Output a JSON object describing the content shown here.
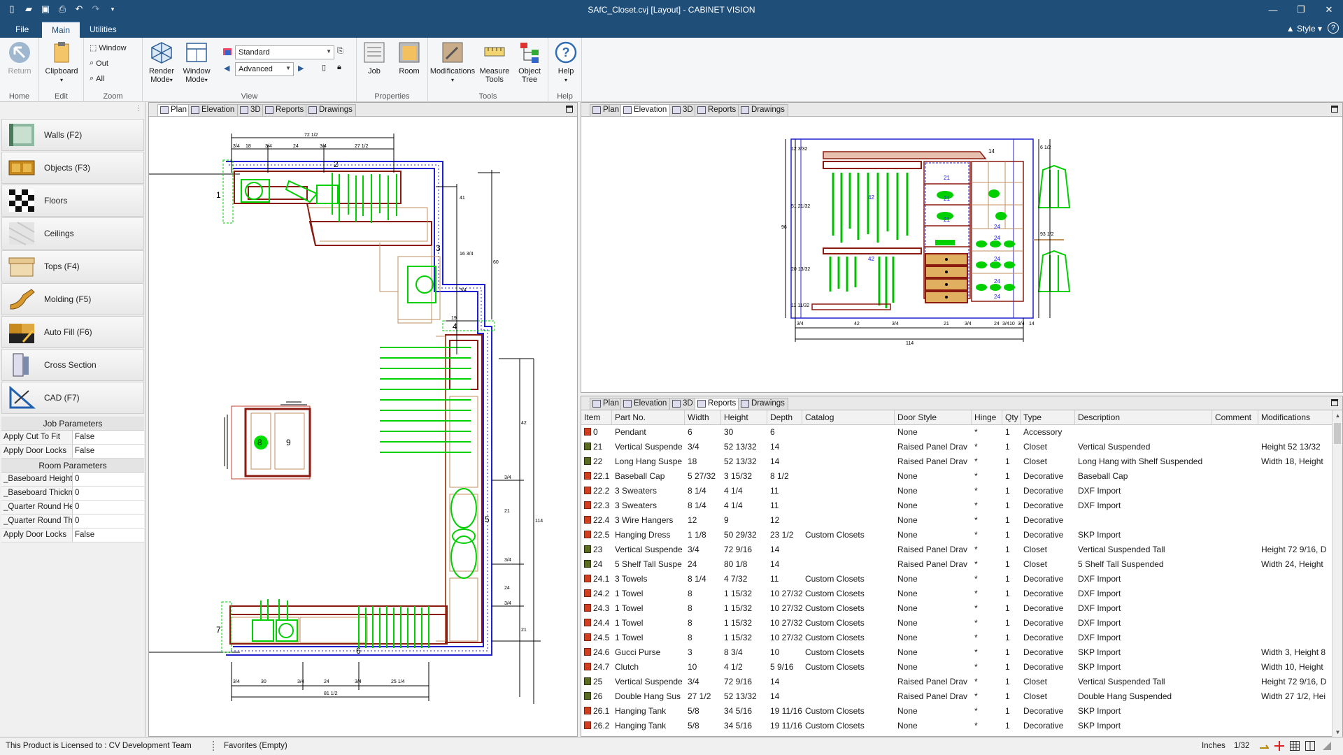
{
  "window": {
    "title": "SAfC_Closet.cvj [Layout] - CABINET VISION"
  },
  "ribbon_tabs": {
    "file": "File",
    "main": "Main",
    "utilities": "Utilities",
    "style": "Style"
  },
  "ribbon": {
    "home": {
      "return_label": "Return",
      "group": "Home"
    },
    "edit": {
      "clipboard_label": "Clipboard",
      "group": "Edit"
    },
    "zoom": {
      "window_label": "Window",
      "out_label": "Out",
      "all_label": "All",
      "group": "Zoom"
    },
    "view": {
      "render_label": "Render Mode",
      "window_mode_label": "Window Mode",
      "style_combo": "Standard",
      "mode_combo": "Advanced",
      "group": "View"
    },
    "properties": {
      "job_label": "Job",
      "room_label": "Room",
      "group": "Properties"
    },
    "tools": {
      "modifications_label": "Modifications",
      "measure_label": "Measure Tools",
      "object_tree_label": "Object Tree",
      "group": "Tools"
    },
    "help": {
      "help_label": "Help",
      "group": "Help"
    }
  },
  "sidebar": {
    "items": [
      {
        "label": "Walls (F2)"
      },
      {
        "label": "Objects (F3)"
      },
      {
        "label": "Floors"
      },
      {
        "label": "Ceilings"
      },
      {
        "label": "Tops (F4)"
      },
      {
        "label": "Molding (F5)"
      },
      {
        "label": "Auto Fill (F6)"
      },
      {
        "label": "Cross Section"
      },
      {
        "label": "CAD (F7)"
      }
    ],
    "job_params_title": "Job Parameters",
    "job_params": [
      {
        "key": "Apply Cut To Fit",
        "value": "False"
      },
      {
        "key": "Apply Door Locks",
        "value": "False"
      }
    ],
    "room_params_title": "Room Parameters",
    "room_params": [
      {
        "key": "_Baseboard Height",
        "value": "0"
      },
      {
        "key": "_Baseboard Thickne",
        "value": "0"
      },
      {
        "key": "_Quarter Round Hei",
        "value": "0"
      },
      {
        "key": "_Quarter Round Thic",
        "value": "0"
      },
      {
        "key": "Apply Door Locks",
        "value": "False"
      }
    ]
  },
  "view_tabs": {
    "plan": "Plan",
    "elevation": "Elevation",
    "three_d": "3D",
    "reports": "Reports",
    "drawings": "Drawings"
  },
  "plan_dims": {
    "top_overall": "72 1/2",
    "top": [
      "3/4",
      "18",
      "3/4",
      "24",
      "3/4",
      "27 1/2"
    ],
    "bottom_overall": "81 1/2",
    "bottom": [
      "3/4",
      "30",
      "3/4",
      "24",
      "3/4",
      "25 1/4"
    ],
    "wall_labels": [
      "1",
      "2",
      "3",
      "4",
      "5",
      "6",
      "7",
      "8",
      "9"
    ],
    "right_dims": [
      "41",
      "16 3/4",
      "60",
      "3/4",
      "19",
      "42",
      "3/4",
      "21",
      "114",
      "3/4",
      "24",
      "3/4",
      "21"
    ]
  },
  "elevation_dims": {
    "bottom_overall": "114",
    "bottom": [
      "3/4",
      "42",
      "3/4",
      "21",
      "3/4",
      "24",
      "3/4",
      "10",
      "3/4",
      "14"
    ],
    "section_labels": [
      "21",
      "21",
      "21",
      "24",
      "24",
      "24",
      "24",
      "24",
      "42",
      "42",
      "14"
    ],
    "left": [
      "96",
      "12 3/32",
      "51 21/32",
      "20 13/32",
      "11 11/32"
    ],
    "right": [
      "6 1/2",
      "93 1/2"
    ]
  },
  "reports": {
    "columns": [
      "Item",
      "Part No.",
      "Width",
      "Height",
      "Depth",
      "Catalog",
      "Door Style",
      "Hinge",
      "Qty",
      "Type",
      "Description",
      "Comment",
      "Modifications"
    ],
    "rows": [
      [
        "0",
        "Pendant",
        "6",
        "30",
        "6",
        "",
        "None",
        "*",
        "1",
        "Accessory",
        "",
        "",
        ""
      ],
      [
        "21",
        "Vertical Suspende",
        "3/4",
        "52 13/32",
        "14",
        "",
        "Raised Panel Drav",
        "*",
        "1",
        "Closet",
        "Vertical Suspended",
        "",
        "Height 52 13/32"
      ],
      [
        "22",
        "Long Hang Suspe",
        "18",
        "52 13/32",
        "14",
        "",
        "Raised Panel Drav",
        "*",
        "1",
        "Closet",
        "Long Hang with Shelf Suspended",
        "",
        "Width 18, Height"
      ],
      [
        "22.1",
        "Baseball Cap",
        "5 27/32",
        "3 15/32",
        "8 1/2",
        "",
        "None",
        "*",
        "1",
        "Decorative",
        "Baseball Cap",
        "",
        ""
      ],
      [
        "22.2",
        "3 Sweaters",
        "8 1/4",
        "4 1/4",
        "11",
        "",
        "None",
        "*",
        "1",
        "Decorative",
        "DXF Import",
        "",
        ""
      ],
      [
        "22.3",
        "3 Sweaters",
        "8 1/4",
        "4 1/4",
        "11",
        "",
        "None",
        "*",
        "1",
        "Decorative",
        "DXF Import",
        "",
        ""
      ],
      [
        "22.4",
        "3 Wire Hangers",
        "12",
        "9",
        "12",
        "",
        "None",
        "*",
        "1",
        "Decorative",
        "",
        "",
        ""
      ],
      [
        "22.5",
        "Hanging Dress",
        "1 1/8",
        "50 29/32",
        "23 1/2",
        "Custom Closets",
        "None",
        "*",
        "1",
        "Decorative",
        "SKP Import",
        "",
        ""
      ],
      [
        "23",
        "Vertical Suspende",
        "3/4",
        "72 9/16",
        "14",
        "",
        "Raised Panel Drav",
        "*",
        "1",
        "Closet",
        "Vertical Suspended Tall",
        "",
        "Height 72 9/16, D"
      ],
      [
        "24",
        "5 Shelf Tall Suspe",
        "24",
        "80 1/8",
        "14",
        "",
        "Raised Panel Drav",
        "*",
        "1",
        "Closet",
        "5 Shelf Tall Suspended",
        "",
        "Width 24, Height"
      ],
      [
        "24.1",
        "3 Towels",
        "8 1/4",
        "4 7/32",
        "11",
        "Custom Closets",
        "None",
        "*",
        "1",
        "Decorative",
        "DXF Import",
        "",
        ""
      ],
      [
        "24.2",
        "1 Towel",
        "8",
        "1 15/32",
        "10 27/32",
        "Custom Closets",
        "None",
        "*",
        "1",
        "Decorative",
        "DXF Import",
        "",
        ""
      ],
      [
        "24.3",
        "1 Towel",
        "8",
        "1 15/32",
        "10 27/32",
        "Custom Closets",
        "None",
        "*",
        "1",
        "Decorative",
        "DXF Import",
        "",
        ""
      ],
      [
        "24.4",
        "1 Towel",
        "8",
        "1 15/32",
        "10 27/32",
        "Custom Closets",
        "None",
        "*",
        "1",
        "Decorative",
        "DXF Import",
        "",
        ""
      ],
      [
        "24.5",
        "1 Towel",
        "8",
        "1 15/32",
        "10 27/32",
        "Custom Closets",
        "None",
        "*",
        "1",
        "Decorative",
        "DXF Import",
        "",
        ""
      ],
      [
        "24.6",
        "Gucci Purse",
        "3",
        "8 3/4",
        "10",
        "Custom Closets",
        "None",
        "*",
        "1",
        "Decorative",
        "SKP Import",
        "",
        "Width 3, Height 8"
      ],
      [
        "24.7",
        "Clutch",
        "10",
        "4 1/2",
        "5 9/16",
        "Custom Closets",
        "None",
        "*",
        "1",
        "Decorative",
        "SKP Import",
        "",
        "Width 10, Height"
      ],
      [
        "25",
        "Vertical Suspende",
        "3/4",
        "72 9/16",
        "14",
        "",
        "Raised Panel Drav",
        "*",
        "1",
        "Closet",
        "Vertical Suspended Tall",
        "",
        "Height 72 9/16, D"
      ],
      [
        "26",
        "Double Hang Sus",
        "27 1/2",
        "52 13/32",
        "14",
        "",
        "Raised Panel Drav",
        "*",
        "1",
        "Closet",
        "Double Hang Suspended",
        "",
        "Width 27 1/2, Hei"
      ],
      [
        "26.1",
        "Hanging Tank",
        "5/8",
        "34 5/16",
        "19 11/16",
        "Custom Closets",
        "None",
        "*",
        "1",
        "Decorative",
        "SKP Import",
        "",
        ""
      ],
      [
        "26.2",
        "Hanging Tank",
        "5/8",
        "34 5/16",
        "19 11/16",
        "Custom Closets",
        "None",
        "*",
        "1",
        "Decorative",
        "SKP Import",
        "",
        ""
      ]
    ]
  },
  "status": {
    "license": "This Product is Licensed to : CV Development Team",
    "favorites": "Favorites (Empty)",
    "units": "Inches",
    "precision": "1/32"
  },
  "colors": {
    "brand": "#1f4e79",
    "accent_green": "#00dd00",
    "cabinet_brown": "#8b3a1a",
    "wall_blue": "#2020d0"
  }
}
